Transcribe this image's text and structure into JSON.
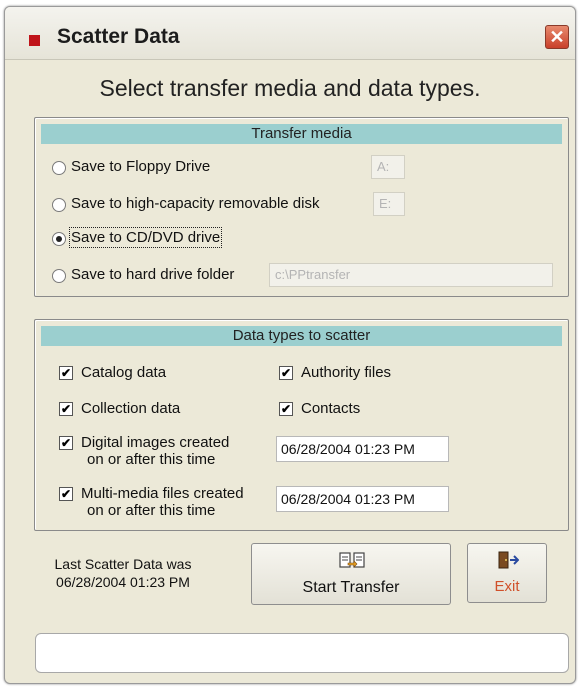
{
  "window": {
    "title": "Scatter Data",
    "close_glyph": "✕"
  },
  "heading": "Select transfer media and data types.",
  "transfer_media": {
    "header": "Transfer media",
    "options": [
      {
        "label": "Save to Floppy Drive",
        "field": "A:",
        "selected": false
      },
      {
        "label": "Save to high-capacity removable disk",
        "field": "E:",
        "selected": false
      },
      {
        "label": "Save to CD/DVD drive",
        "selected": true
      },
      {
        "label": "Save to hard drive folder",
        "field": "c:\\PPtransfer",
        "selected": false
      }
    ]
  },
  "data_types": {
    "header": "Data types to scatter",
    "catalog": "Catalog data",
    "authority": "Authority files",
    "collection": "Collection data",
    "contacts": "Contacts",
    "digital_line1": "Digital images created",
    "digital_line2": "on or after this time",
    "digital_date": "06/28/2004 01:23 PM",
    "multimedia_line1": "Multi-media files created",
    "multimedia_line2": "on or after this time",
    "multimedia_date": "06/28/2004 01:23 PM",
    "check_glyph": "✔"
  },
  "last_scatter": {
    "line1": "Last Scatter Data was",
    "line2": "06/28/2004 01:23 PM"
  },
  "buttons": {
    "start": "Start Transfer",
    "exit": "Exit"
  },
  "icons": {
    "start": "transfer-icon",
    "exit": "exit-door-icon"
  },
  "colors": {
    "group_header": "#9bcfcf",
    "exit_text": "#d0502a",
    "close": "#c9402a"
  }
}
